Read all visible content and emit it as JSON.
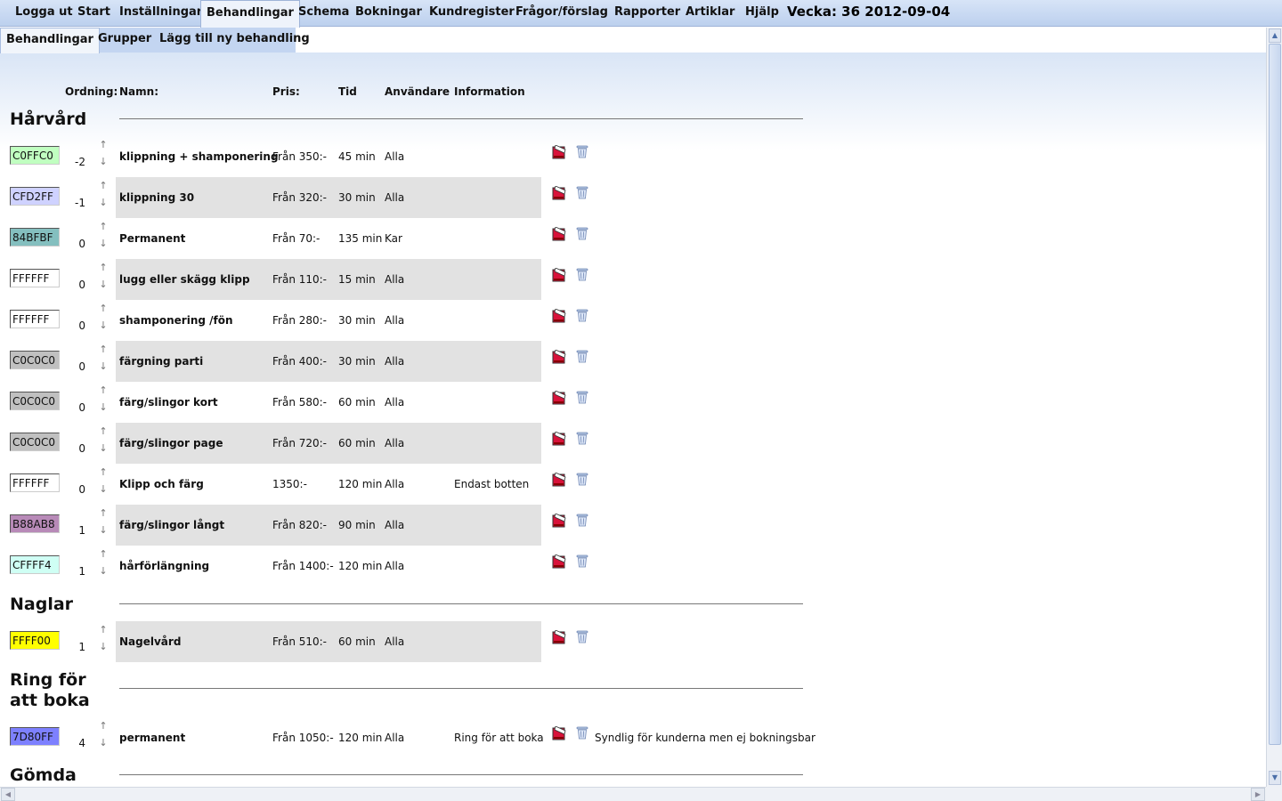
{
  "topnav": {
    "items": [
      {
        "label": "Logga ut"
      },
      {
        "label": "Start"
      },
      {
        "label": "Inställningar"
      },
      {
        "label": "Behandlingar"
      },
      {
        "label": "Schema"
      },
      {
        "label": "Bokningar"
      },
      {
        "label": "Kundregister"
      },
      {
        "label": "Frågor/förslag"
      },
      {
        "label": "Rapporter"
      },
      {
        "label": "Artiklar"
      },
      {
        "label": "Hjälp"
      }
    ],
    "active": "Behandlingar",
    "week_label": "Vecka: 36 2012-09-04"
  },
  "subnav": {
    "items": [
      {
        "label": "Behandlingar"
      },
      {
        "label": "Grupper"
      },
      {
        "label": "Lägg till ny behandling"
      }
    ],
    "active": "Behandlingar"
  },
  "columns": {
    "order": "Ordning:",
    "name": "Namn:",
    "price": "Pris:",
    "time": "Tid",
    "user": "Användare",
    "info": "Information"
  },
  "icons": {
    "edit": "edit-icon",
    "delete": "trash-icon",
    "up": "arrow-up-icon",
    "down": "arrow-down-icon"
  },
  "groups": [
    {
      "title": "Hårvård",
      "rows": [
        {
          "color": "C0FFC0",
          "order": "-2",
          "name": "klippning + shamponering",
          "price": "Från 350:-",
          "time": "45 min",
          "user": "Alla",
          "info": "",
          "extra": ""
        },
        {
          "color": "CFD2FF",
          "order": "-1",
          "name": "klippning 30",
          "price": "Från 320:-",
          "time": "30 min",
          "user": "Alla",
          "info": "",
          "extra": ""
        },
        {
          "color": "84BFBF",
          "order": "0",
          "name": "Permanent",
          "price": "Från 70:-",
          "time": "135 min",
          "user": "Kar",
          "info": "",
          "extra": ""
        },
        {
          "color": "FFFFFF",
          "order": "0",
          "name": "lugg eller skägg klipp",
          "price": "Från 110:-",
          "time": "15 min",
          "user": "Alla",
          "info": "",
          "extra": ""
        },
        {
          "color": "FFFFFF",
          "order": "0",
          "name": "shamponering /fön",
          "price": "Från 280:-",
          "time": "30 min",
          "user": "Alla",
          "info": "",
          "extra": ""
        },
        {
          "color": "C0C0C0",
          "order": "0",
          "name": "färgning parti",
          "price": "Från 400:-",
          "time": "30 min",
          "user": "Alla",
          "info": "",
          "extra": ""
        },
        {
          "color": "C0C0C0",
          "order": "0",
          "name": "färg/slingor kort",
          "price": "Från 580:-",
          "time": "60 min",
          "user": "Alla",
          "info": "",
          "extra": ""
        },
        {
          "color": "C0C0C0",
          "order": "0",
          "name": "färg/slingor page",
          "price": "Från 720:-",
          "time": "60 min",
          "user": "Alla",
          "info": "",
          "extra": ""
        },
        {
          "color": "FFFFFF",
          "order": "0",
          "name": "Klipp och färg",
          "price": "1350:-",
          "time": "120 min",
          "user": "Alla",
          "info": "Endast botten",
          "extra": ""
        },
        {
          "color": "B88AB8",
          "order": "1",
          "name": "färg/slingor långt",
          "price": "Från 820:-",
          "time": "90 min",
          "user": "Alla",
          "info": "",
          "extra": ""
        },
        {
          "color": "CFFFF4",
          "order": "1",
          "name": "hårförlängning",
          "price": "Från 1400:-",
          "time": "120 min",
          "user": "Alla",
          "info": "",
          "extra": ""
        }
      ]
    },
    {
      "title": "Naglar",
      "rows": [
        {
          "color": "FFFF00",
          "order": "1",
          "name": "Nagelvård",
          "price": "Från 510:-",
          "time": "60 min",
          "user": "Alla",
          "info": "",
          "extra": ""
        }
      ]
    },
    {
      "title": "Ring för att boka",
      "rows": [
        {
          "color": "7D80FF",
          "order": "4",
          "name": "permanent",
          "price": "Från 1050:-",
          "time": "120 min",
          "user": "Alla",
          "info": "Ring för att boka",
          "extra": "Syndlig för kunderna men ej bokningsbar"
        }
      ]
    },
    {
      "title": "Gömda",
      "rows": []
    }
  ]
}
